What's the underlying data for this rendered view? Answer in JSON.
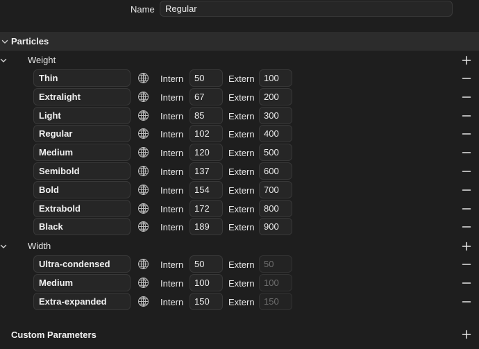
{
  "name": {
    "label": "Name",
    "value": "Regular"
  },
  "particles": {
    "title": "Particles",
    "groups": [
      {
        "title": "Weight",
        "rows": [
          {
            "name": "Thin",
            "intern_label": "Intern",
            "intern": "50",
            "extern_label": "Extern",
            "extern": "100",
            "extern_placeholder": false
          },
          {
            "name": "Extralight",
            "intern_label": "Intern",
            "intern": "67",
            "extern_label": "Extern",
            "extern": "200",
            "extern_placeholder": false
          },
          {
            "name": "Light",
            "intern_label": "Intern",
            "intern": "85",
            "extern_label": "Extern",
            "extern": "300",
            "extern_placeholder": false
          },
          {
            "name": "Regular",
            "intern_label": "Intern",
            "intern": "102",
            "extern_label": "Extern",
            "extern": "400",
            "extern_placeholder": false
          },
          {
            "name": "Medium",
            "intern_label": "Intern",
            "intern": "120",
            "extern_label": "Extern",
            "extern": "500",
            "extern_placeholder": false
          },
          {
            "name": "Semibold",
            "intern_label": "Intern",
            "intern": "137",
            "extern_label": "Extern",
            "extern": "600",
            "extern_placeholder": false
          },
          {
            "name": "Bold",
            "intern_label": "Intern",
            "intern": "154",
            "extern_label": "Extern",
            "extern": "700",
            "extern_placeholder": false
          },
          {
            "name": "Extrabold",
            "intern_label": "Intern",
            "intern": "172",
            "extern_label": "Extern",
            "extern": "800",
            "extern_placeholder": false
          },
          {
            "name": "Black",
            "intern_label": "Intern",
            "intern": "189",
            "extern_label": "Extern",
            "extern": "900",
            "extern_placeholder": false
          }
        ]
      },
      {
        "title": "Width",
        "rows": [
          {
            "name": "Ultra-condensed",
            "intern_label": "Intern",
            "intern": "50",
            "extern_label": "Extern",
            "extern": "50",
            "extern_placeholder": true
          },
          {
            "name": "Medium",
            "intern_label": "Intern",
            "intern": "100",
            "extern_label": "Extern",
            "extern": "100",
            "extern_placeholder": true
          },
          {
            "name": "Extra-expanded",
            "intern_label": "Intern",
            "intern": "150",
            "extern_label": "Extern",
            "extern": "150",
            "extern_placeholder": true
          }
        ]
      }
    ]
  },
  "custom_parameters": {
    "title": "Custom Parameters"
  },
  "icons": {
    "disclosure": "chevron-down-icon",
    "localize": "globe-icon",
    "add": "plus-icon",
    "remove": "minus-icon"
  },
  "colors": {
    "background": "#1e1e1e",
    "section_header": "#2c2c2c",
    "field": "#262626",
    "text": "#e6e6e6",
    "placeholder_text": "#6e6e6e"
  }
}
